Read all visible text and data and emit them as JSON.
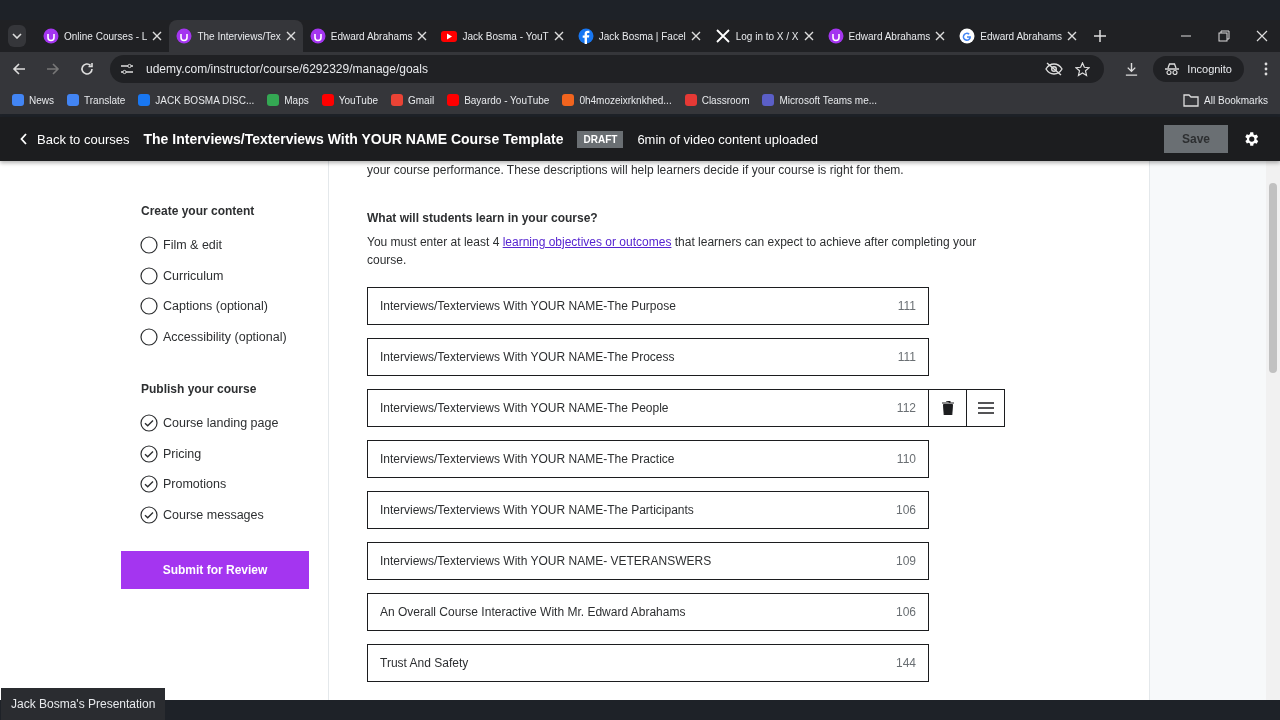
{
  "browser": {
    "tabs": [
      {
        "title": "Online Courses - L",
        "kind": "udemy",
        "selected": false
      },
      {
        "title": "The Interviews/Tex",
        "kind": "udemy",
        "selected": true
      },
      {
        "title": "Edward Abrahams",
        "kind": "udemy",
        "selected": false
      },
      {
        "title": "Jack Bosma - YouT",
        "kind": "youtube",
        "selected": false
      },
      {
        "title": "Jack Bosma | Facel",
        "kind": "facebook",
        "selected": false
      },
      {
        "title": "Log in to X / X",
        "kind": "x",
        "selected": false
      },
      {
        "title": "Edward Abrahams",
        "kind": "udemy",
        "selected": false
      },
      {
        "title": "Edward Abrahams",
        "kind": "google",
        "selected": false
      }
    ],
    "address": "udemy.com/instructor/course/6292329/manage/goals",
    "profile": "Incognito",
    "bookmarks": [
      {
        "label": "News",
        "kind": "news"
      },
      {
        "label": "Translate",
        "kind": "translate"
      },
      {
        "label": "JACK BOSMA DISC...",
        "kind": "facebook"
      },
      {
        "label": "Maps",
        "kind": "maps"
      },
      {
        "label": "YouTube",
        "kind": "youtube"
      },
      {
        "label": "Gmail",
        "kind": "gmail"
      },
      {
        "label": "Bayardo - YouTube",
        "kind": "youtube"
      },
      {
        "label": "0h4mozeixrknkhed...",
        "kind": "etsy"
      },
      {
        "label": "Classroom",
        "kind": "sk"
      },
      {
        "label": "Microsoft Teams me...",
        "kind": "teams"
      }
    ],
    "all_bookmarks": "All Bookmarks"
  },
  "header": {
    "back": "Back to courses",
    "title": "The Interviews/Texterviews With YOUR NAME Course Template",
    "badge": "DRAFT",
    "status": "6min of video content uploaded",
    "save": "Save"
  },
  "sidebar": {
    "sections": [
      {
        "heading": "Create your content",
        "items": [
          {
            "label": "Film & edit",
            "checked": false
          },
          {
            "label": "Curriculum",
            "checked": false
          },
          {
            "label": "Captions (optional)",
            "checked": false
          },
          {
            "label": "Accessibility (optional)",
            "checked": false
          }
        ]
      },
      {
        "heading": "Publish your course",
        "items": [
          {
            "label": "Course landing page",
            "checked": true
          },
          {
            "label": "Pricing",
            "checked": true
          },
          {
            "label": "Promotions",
            "checked": true
          },
          {
            "label": "Course messages",
            "checked": true
          }
        ]
      }
    ],
    "submit": "Submit for Review"
  },
  "main": {
    "intro": "your course performance. These descriptions will help learners decide if your course is right for them.",
    "question": "What will students learn in your course?",
    "hint_before": "You must enter at least 4 ",
    "hint_link": "learning objectives or outcomes",
    "hint_after": " that learners can expect to achieve after completing your course.",
    "objectives": [
      {
        "value": "Interviews/Texterviews With YOUR NAME-The Purpose",
        "remaining": "111",
        "show_actions": false
      },
      {
        "value": "Interviews/Texterviews With YOUR NAME-The Process",
        "remaining": "111",
        "show_actions": false
      },
      {
        "value": "Interviews/Texterviews With YOUR NAME-The People",
        "remaining": "112",
        "show_actions": true
      },
      {
        "value": "Interviews/Texterviews With YOUR NAME-The Practice",
        "remaining": "110",
        "show_actions": false
      },
      {
        "value": "Interviews/Texterviews With YOUR NAME-The Participants",
        "remaining": "106",
        "show_actions": false
      },
      {
        "value": "Interviews/Texterviews With YOUR NAME- VETERANSWERS",
        "remaining": "109",
        "show_actions": false
      },
      {
        "value": "An Overall Course Interactive With Mr. Edward Abrahams",
        "remaining": "106",
        "show_actions": false
      },
      {
        "value": "Trust And Safety",
        "remaining": "144",
        "show_actions": false
      }
    ]
  },
  "presentation_label": "Jack Bosma's Presentation"
}
